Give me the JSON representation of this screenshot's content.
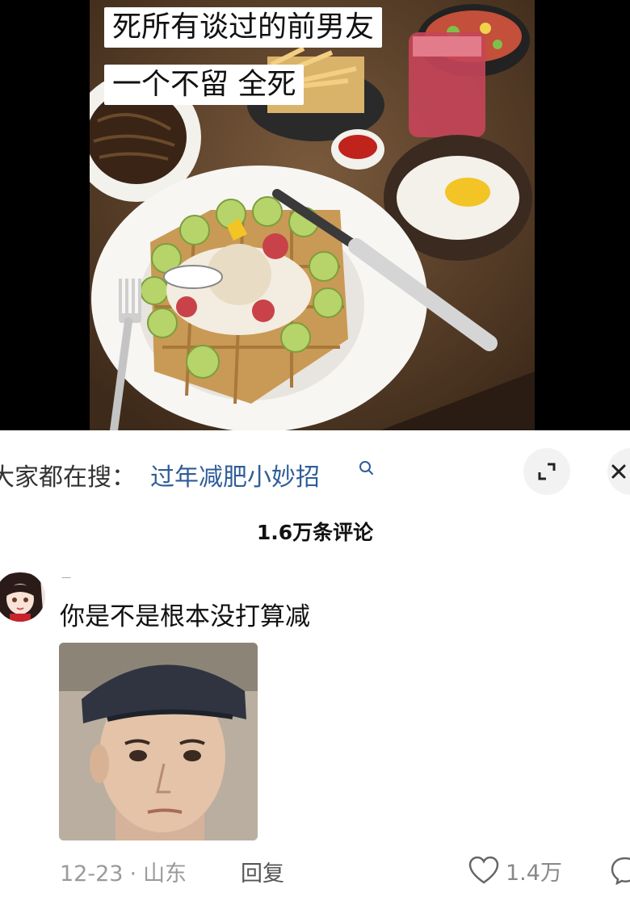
{
  "video": {
    "caption_line1": "死所有谈过的前男友",
    "caption_line2": "一个不留 全死"
  },
  "search": {
    "prefix": "大家都在搜：",
    "query": "过年减肥小妙招"
  },
  "comments": {
    "count_label": "1.6万条评论",
    "items": [
      {
        "username": "一",
        "text": "你是不是根本没打算减",
        "date": "12-23",
        "separator": "·",
        "location": "山东",
        "reply_label": "回复",
        "likes": "1.4万"
      }
    ]
  },
  "colors": {
    "search_query": "#2f5d98",
    "video_background": "#000000"
  }
}
